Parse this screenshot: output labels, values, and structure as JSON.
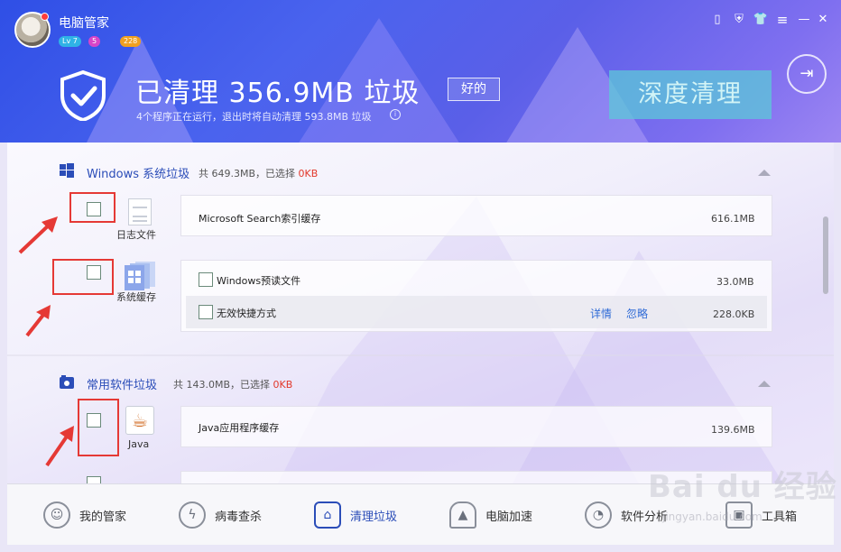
{
  "app": {
    "name": "电脑管家",
    "level": "Lv 7",
    "badge2": "5",
    "coins": "228"
  },
  "window_buttons": [
    "phone-icon",
    "shield-small-icon",
    "shirt-icon",
    "menu-icon",
    "minimize-icon",
    "close-icon"
  ],
  "header": {
    "title": "已清理 356.9MB 垃圾",
    "good_button": "好的",
    "subtitle": "4个程序正在运行，退出时将自动清理 593.8MB 垃圾",
    "deep_clean": "深度清理"
  },
  "sections": [
    {
      "title": "Windows 系统垃圾",
      "meta_prefix": "共 649.3MB，已选择 ",
      "meta_selected": "0KB",
      "groups": [
        {
          "label": "日志文件",
          "items": [
            {
              "text": "Microsoft Search索引缓存",
              "size": "616.1MB"
            }
          ]
        },
        {
          "label": "系统缓存",
          "items": [
            {
              "text": "Windows预读文件",
              "size": "33.0MB"
            },
            {
              "text": "无效快捷方式",
              "size": "228.0KB",
              "detail": "详情",
              "ignore": "忽略"
            }
          ]
        }
      ]
    },
    {
      "title": "常用软件垃圾",
      "meta_prefix": "共 143.0MB，已选择 ",
      "meta_selected": "0KB",
      "groups": [
        {
          "label": "Java",
          "items": [
            {
              "text": "Java应用程序缓存",
              "size": "139.6MB"
            }
          ]
        }
      ]
    }
  ],
  "bottom_nav": [
    {
      "label": "我的管家",
      "icon": "butler-icon"
    },
    {
      "label": "病毒查杀",
      "icon": "virus-scan-icon"
    },
    {
      "label": "清理垃圾",
      "icon": "cleanup-icon",
      "active": true
    },
    {
      "label": "电脑加速",
      "icon": "rocket-icon"
    },
    {
      "label": "软件分析",
      "icon": "software-analysis-icon"
    },
    {
      "label": "工具箱",
      "icon": "toolbox-icon"
    }
  ],
  "watermark": {
    "logo": "Bai du 经验",
    "url": "jingyan.baidu.com"
  },
  "colors": {
    "header": "#3f55ea",
    "accent": "#2b4db8",
    "highlight": "#e53935",
    "selected": "#e2382b"
  }
}
